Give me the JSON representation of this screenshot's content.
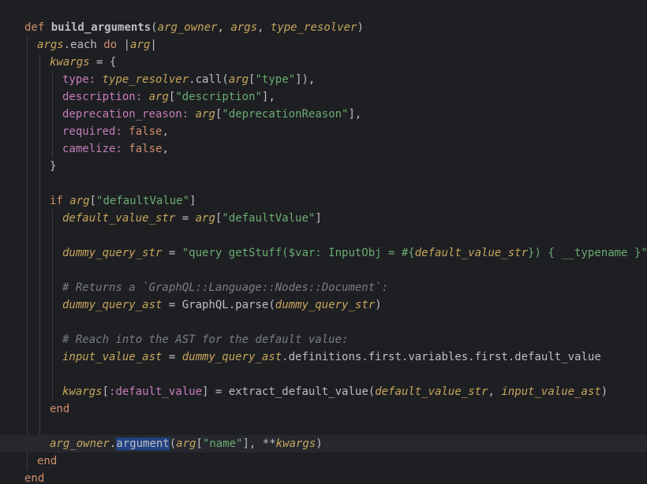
{
  "editor": {
    "language": "ruby",
    "current_line_index": 25,
    "lines": [
      {
        "indent": 0,
        "tokens": []
      },
      {
        "indent": 0,
        "tokens": [
          {
            "t": "def ",
            "c": "kw"
          },
          {
            "t": "build_",
            "c": "def"
          },
          {
            "t": "arguments",
            "c": "def"
          },
          {
            "t": "(",
            "c": "plain"
          },
          {
            "t": "arg_owner",
            "c": "var"
          },
          {
            "t": ", ",
            "c": "plain"
          },
          {
            "t": "args",
            "c": "var"
          },
          {
            "t": ", ",
            "c": "plain"
          },
          {
            "t": "type_resolver",
            "c": "var"
          },
          {
            "t": ")",
            "c": "plain"
          }
        ]
      },
      {
        "indent": 1,
        "tokens": [
          {
            "t": "args",
            "c": "var"
          },
          {
            "t": ".each ",
            "c": "plain"
          },
          {
            "t": "do",
            "c": "kw"
          },
          {
            "t": " |",
            "c": "plain"
          },
          {
            "t": "arg",
            "c": "var"
          },
          {
            "t": "|",
            "c": "plain"
          }
        ]
      },
      {
        "indent": 2,
        "tokens": [
          {
            "t": "kwargs",
            "c": "var"
          },
          {
            "t": " = {",
            "c": "plain"
          }
        ]
      },
      {
        "indent": 3,
        "tokens": [
          {
            "t": "type:",
            "c": "sym"
          },
          {
            "t": " ",
            "c": "plain"
          },
          {
            "t": "type_resolver",
            "c": "var"
          },
          {
            "t": ".call(",
            "c": "plain"
          },
          {
            "t": "arg",
            "c": "var"
          },
          {
            "t": "[",
            "c": "plain"
          },
          {
            "t": "\"type\"",
            "c": "str"
          },
          {
            "t": "]),",
            "c": "plain"
          }
        ]
      },
      {
        "indent": 3,
        "tokens": [
          {
            "t": "description:",
            "c": "sym"
          },
          {
            "t": " ",
            "c": "plain"
          },
          {
            "t": "arg",
            "c": "var"
          },
          {
            "t": "[",
            "c": "plain"
          },
          {
            "t": "\"description\"",
            "c": "str"
          },
          {
            "t": "],",
            "c": "plain"
          }
        ]
      },
      {
        "indent": 3,
        "tokens": [
          {
            "t": "deprecation_reason:",
            "c": "sym"
          },
          {
            "t": " ",
            "c": "plain"
          },
          {
            "t": "arg",
            "c": "var"
          },
          {
            "t": "[",
            "c": "plain"
          },
          {
            "t": "\"deprecationReason\"",
            "c": "str"
          },
          {
            "t": "],",
            "c": "plain"
          }
        ]
      },
      {
        "indent": 3,
        "tokens": [
          {
            "t": "required:",
            "c": "sym"
          },
          {
            "t": " ",
            "c": "plain"
          },
          {
            "t": "false",
            "c": "kw"
          },
          {
            "t": ",",
            "c": "plain"
          }
        ]
      },
      {
        "indent": 3,
        "tokens": [
          {
            "t": "camelize:",
            "c": "sym"
          },
          {
            "t": " ",
            "c": "plain"
          },
          {
            "t": "false",
            "c": "kw"
          },
          {
            "t": ",",
            "c": "plain"
          }
        ]
      },
      {
        "indent": 2,
        "tokens": [
          {
            "t": "}",
            "c": "plain"
          }
        ]
      },
      {
        "indent": 0,
        "tokens": []
      },
      {
        "indent": 2,
        "tokens": [
          {
            "t": "if ",
            "c": "kw"
          },
          {
            "t": "arg",
            "c": "var"
          },
          {
            "t": "[",
            "c": "plain"
          },
          {
            "t": "\"defaultValue\"",
            "c": "str"
          },
          {
            "t": "]",
            "c": "plain"
          }
        ]
      },
      {
        "indent": 3,
        "tokens": [
          {
            "t": "default_value_str",
            "c": "var"
          },
          {
            "t": " = ",
            "c": "plain"
          },
          {
            "t": "arg",
            "c": "var"
          },
          {
            "t": "[",
            "c": "plain"
          },
          {
            "t": "\"defaultValue\"",
            "c": "str"
          },
          {
            "t": "]",
            "c": "plain"
          }
        ]
      },
      {
        "indent": 0,
        "tokens": []
      },
      {
        "indent": 3,
        "tokens": [
          {
            "t": "dummy_query_str",
            "c": "var"
          },
          {
            "t": " = ",
            "c": "plain"
          },
          {
            "t": "\"query getStuff($var: InputObj = #{",
            "c": "str"
          },
          {
            "t": "default_value_str",
            "c": "var"
          },
          {
            "t": "}) { __typename }\"",
            "c": "str"
          }
        ]
      },
      {
        "indent": 0,
        "tokens": []
      },
      {
        "indent": 3,
        "tokens": [
          {
            "t": "# Returns a `GraphQL::Language::Nodes::Document`:",
            "c": "cmt"
          }
        ]
      },
      {
        "indent": 3,
        "tokens": [
          {
            "t": "dummy_query_ast",
            "c": "var"
          },
          {
            "t": " = ",
            "c": "plain"
          },
          {
            "t": "GraphQL",
            "c": "const"
          },
          {
            "t": ".parse(",
            "c": "plain"
          },
          {
            "t": "dummy_query_str",
            "c": "var"
          },
          {
            "t": ")",
            "c": "plain"
          }
        ]
      },
      {
        "indent": 0,
        "tokens": []
      },
      {
        "indent": 3,
        "tokens": [
          {
            "t": "# Reach into the AST for the default value:",
            "c": "cmt"
          }
        ]
      },
      {
        "indent": 3,
        "tokens": [
          {
            "t": "input_value_ast",
            "c": "var"
          },
          {
            "t": " = ",
            "c": "plain"
          },
          {
            "t": "dummy_query_ast",
            "c": "var"
          },
          {
            "t": ".definitions.first.variables.first.default_value",
            "c": "plain"
          }
        ]
      },
      {
        "indent": 0,
        "tokens": []
      },
      {
        "indent": 3,
        "tokens": [
          {
            "t": "kwargs",
            "c": "var"
          },
          {
            "t": "[",
            "c": "plain"
          },
          {
            "t": ":default_value",
            "c": "sym"
          },
          {
            "t": "] = extract_default_value(",
            "c": "plain"
          },
          {
            "t": "default_value_str",
            "c": "var"
          },
          {
            "t": ", ",
            "c": "plain"
          },
          {
            "t": "input_value_ast",
            "c": "var"
          },
          {
            "t": ")",
            "c": "plain"
          }
        ]
      },
      {
        "indent": 2,
        "tokens": [
          {
            "t": "end",
            "c": "kw"
          }
        ]
      },
      {
        "indent": 0,
        "tokens": []
      },
      {
        "indent": 2,
        "tokens": [
          {
            "t": "arg_owner",
            "c": "var"
          },
          {
            "t": ".",
            "c": "plain"
          },
          {
            "t": "argument",
            "c": "plain",
            "sel": true
          },
          {
            "t": "(",
            "c": "plain"
          },
          {
            "t": "arg",
            "c": "var"
          },
          {
            "t": "[",
            "c": "plain"
          },
          {
            "t": "\"name\"",
            "c": "str"
          },
          {
            "t": "], **",
            "c": "plain"
          },
          {
            "t": "kwargs",
            "c": "var"
          },
          {
            "t": ")",
            "c": "plain"
          }
        ]
      },
      {
        "indent": 1,
        "tokens": [
          {
            "t": "end",
            "c": "kw"
          }
        ]
      },
      {
        "indent": 0,
        "tokens": [
          {
            "t": "end",
            "c": "kw"
          }
        ]
      }
    ]
  }
}
